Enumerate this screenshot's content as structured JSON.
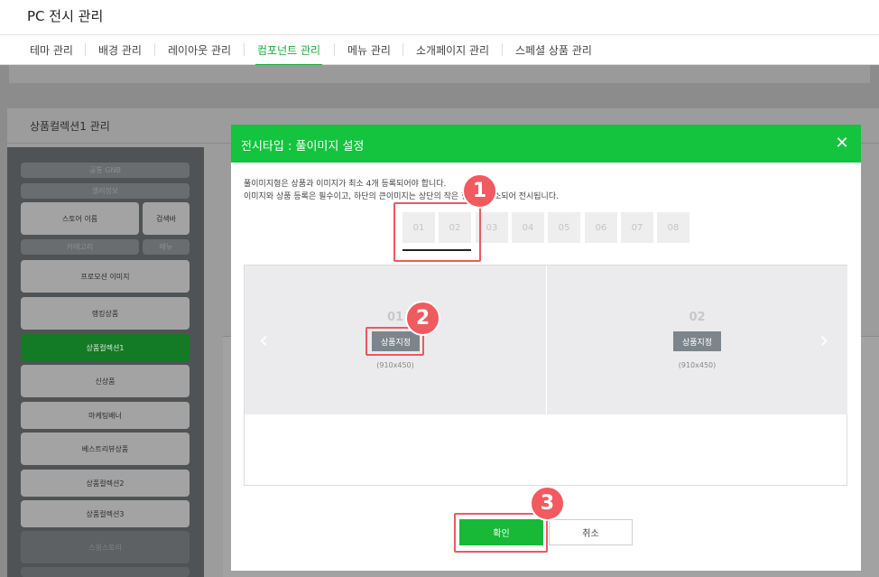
{
  "header": {
    "title": "PC 전시 관리"
  },
  "tabs": [
    {
      "label": "테마 관리"
    },
    {
      "label": "배경 관리"
    },
    {
      "label": "레이아웃 관리"
    },
    {
      "label": "컴포넌트 관리",
      "active": true
    },
    {
      "label": "메뉴 관리"
    },
    {
      "label": "소개페이지 관리"
    },
    {
      "label": "스페셜 상품 관리"
    }
  ],
  "background": {
    "panel_title": "상품컬렉션1 관리",
    "sidebar": {
      "common_gnb": "공통 GNB",
      "seller_info": "셀러정보",
      "store_name": "스토어 이름",
      "search_bar": "검색바",
      "category": "카테고리",
      "menu": "메뉴",
      "items": [
        "프로모션 이미지",
        "랭킹상품",
        "상품컬렉션1",
        "신상품",
        "마케팅배너",
        "베스트리뷰상품",
        "상품컬렉션2",
        "상품컬렉션3",
        "스윙스토리"
      ]
    }
  },
  "modal": {
    "title": "전시타입 : 풀이미지 설정",
    "close_icon": "close-icon",
    "desc_line1": "풀이미지형은 상품과 이미지가 최소 4개 등록되어야 합니다.",
    "desc_line2": "이미지와 상품 등록은 필수이고, 하단의 큰이미지는 상단의 작은 형태로 축소되어 전시됩니다.",
    "slots": [
      "01",
      "02",
      "03",
      "04",
      "05",
      "06",
      "07",
      "08"
    ],
    "preview": [
      {
        "num": "01",
        "button": "상품지정",
        "size": "(910x450)"
      },
      {
        "num": "02",
        "button": "상품지정",
        "size": "(910x450)"
      }
    ],
    "prev_icon": "chevron-left-icon",
    "next_icon": "chevron-right-icon",
    "confirm": "확인",
    "cancel": "취소"
  },
  "callouts": [
    "1",
    "2",
    "3"
  ],
  "colors": {
    "accent": "#14c43e",
    "callout": "#f15a5e"
  }
}
